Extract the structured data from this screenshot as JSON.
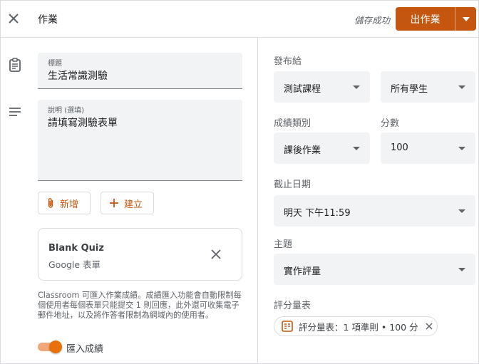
{
  "header": {
    "title": "作業",
    "saved_status": "儲存成功",
    "assign_label": "出作業"
  },
  "form": {
    "title_label": "標題",
    "title_value": "生活常識測驗",
    "description_label": "說明 (選填)",
    "description_value": "請填寫測驗表單",
    "add_label": "新增",
    "create_label": "建立"
  },
  "attachment": {
    "title": "Blank Quiz",
    "subtitle": "Google 表單"
  },
  "grade_import": {
    "note": "Classroom 可匯入作業成績。成績匯入功能會自動限制每個使用者每個表單只能提交 1 則回應，此外還可收集電子郵件地址，以及將作答者限制為網域內的使用者。",
    "toggle_label": "匯入成績",
    "enabled": true
  },
  "settings": {
    "for_label": "發布給",
    "class_value": "測試課程",
    "students_value": "所有學生",
    "category_label": "成績類別",
    "category_value": "課後作業",
    "points_label": "分數",
    "points_value": "100",
    "due_label": "截止日期",
    "due_value": "明天 下午11:59",
    "topic_label": "主題",
    "topic_value": "實作評量",
    "rubric_label": "評分量表",
    "rubric_chip": "評分量表：1 項準則 • 100 分"
  },
  "colors": {
    "accent": "#c5560f",
    "toggle": "#e8710a",
    "field_bg": "#f1f3f4"
  }
}
